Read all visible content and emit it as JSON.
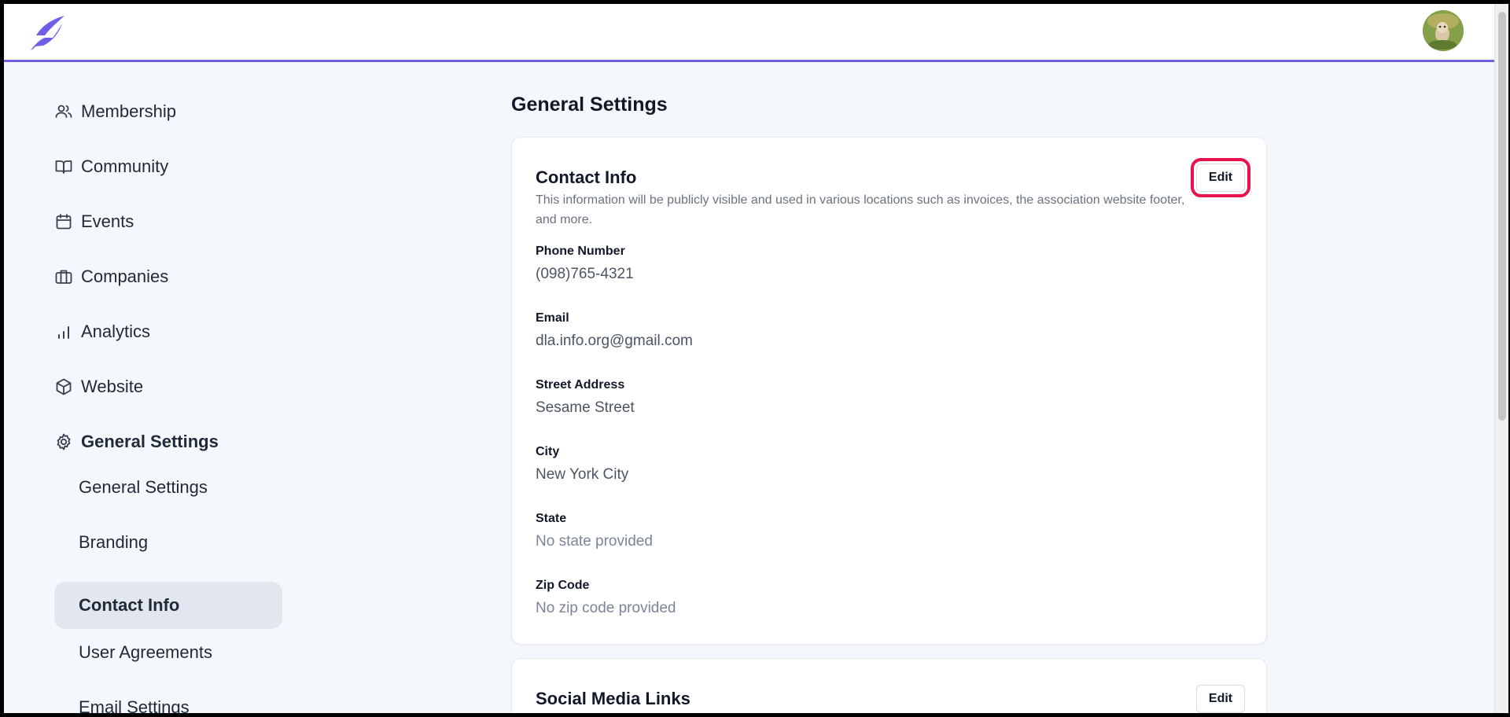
{
  "header": {
    "logo_icon": "feather-logo-icon",
    "avatar_icon": "user-avatar",
    "accent_color": "#6d5fe6"
  },
  "sidebar": {
    "items": [
      {
        "label": "Membership",
        "icon": "users-icon"
      },
      {
        "label": "Community",
        "icon": "book-open-icon"
      },
      {
        "label": "Events",
        "icon": "calendar-icon"
      },
      {
        "label": "Companies",
        "icon": "briefcase-icon"
      },
      {
        "label": "Analytics",
        "icon": "bar-chart-icon"
      },
      {
        "label": "Website",
        "icon": "cube-icon"
      },
      {
        "label": "General Settings",
        "icon": "gear-icon",
        "active": true
      }
    ],
    "sub_items": [
      {
        "label": "General Settings"
      },
      {
        "label": "Branding"
      },
      {
        "label": "Contact Info",
        "selected": true
      },
      {
        "label": "User Agreements"
      },
      {
        "label": "Email Settings"
      }
    ]
  },
  "main": {
    "title": "General Settings",
    "contact_card": {
      "title": "Contact Info",
      "description": "This information will be publicly visible and used in various locations such as invoices, the association website footer, and more.",
      "edit_label": "Edit",
      "fields": [
        {
          "label": "Phone Number",
          "value": "(098)765-4321"
        },
        {
          "label": "Email",
          "value": "dla.info.org@gmail.com"
        },
        {
          "label": "Street Address",
          "value": "Sesame Street"
        },
        {
          "label": "City",
          "value": "New York City"
        },
        {
          "label": "State",
          "value": "No state provided"
        },
        {
          "label": "Zip Code",
          "value": "No zip code provided"
        }
      ]
    },
    "social_card": {
      "title": "Social Media Links",
      "edit_label": "Edit"
    }
  },
  "colors": {
    "highlight": "#e8134d",
    "selected_bg": "#e2e6ee"
  }
}
